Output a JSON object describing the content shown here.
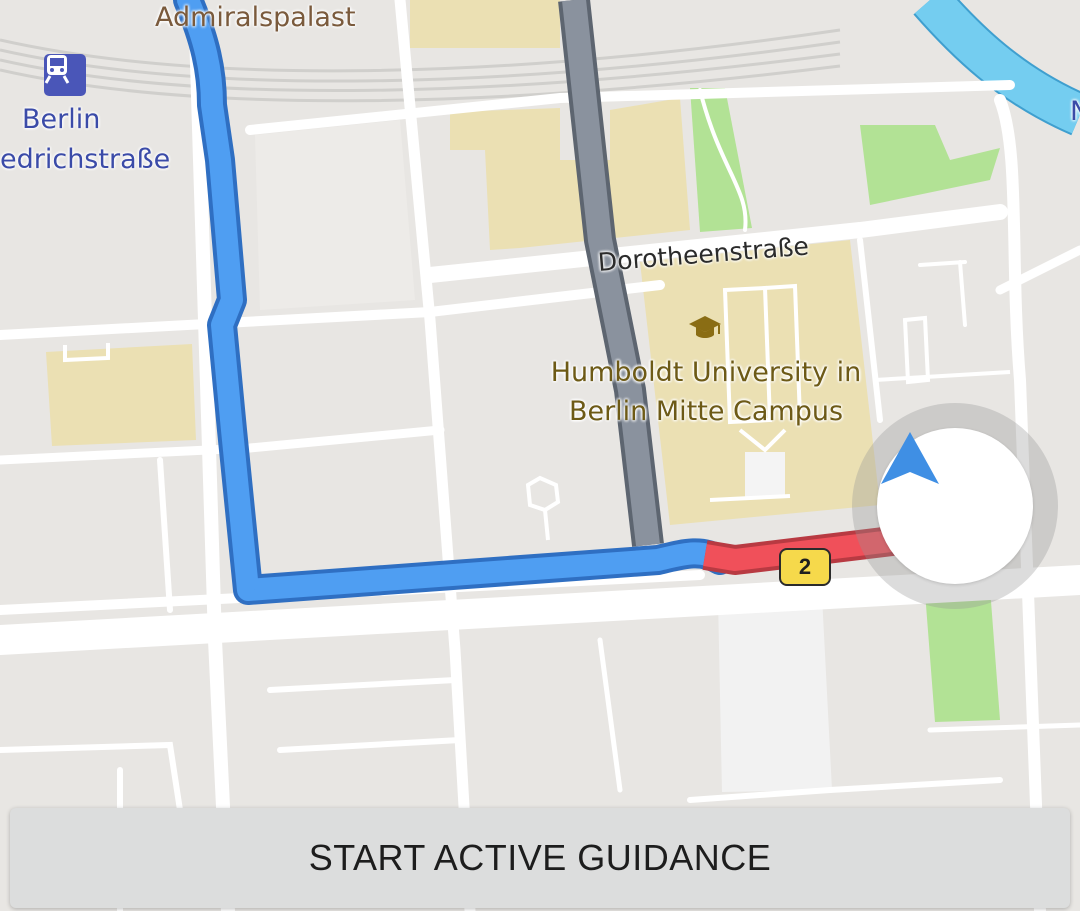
{
  "map": {
    "labels": {
      "admiralspalast": "Admiralspalast",
      "station_line1": "Berlin",
      "station_line2": "edrichstraße",
      "street_dorotheenstrasse": "Dorotheenstraße",
      "university_line1": "Humboldt University in",
      "university_line2": "Berlin Mitte Campus",
      "partial_right": "N"
    },
    "icons": {
      "station": "train-station-icon",
      "university": "graduation-cap-icon",
      "location": "navigation-arrow-icon"
    },
    "route": {
      "badge": "2",
      "colors": {
        "route": "#4f9ef2",
        "route_outline": "#2f6fc2",
        "traffic": "#f0505a",
        "water": "#74cdf0",
        "park": "#b2e295",
        "campus": "#ebe0b3"
      }
    }
  },
  "actions": {
    "start_guidance_label": "START ACTIVE GUIDANCE"
  }
}
